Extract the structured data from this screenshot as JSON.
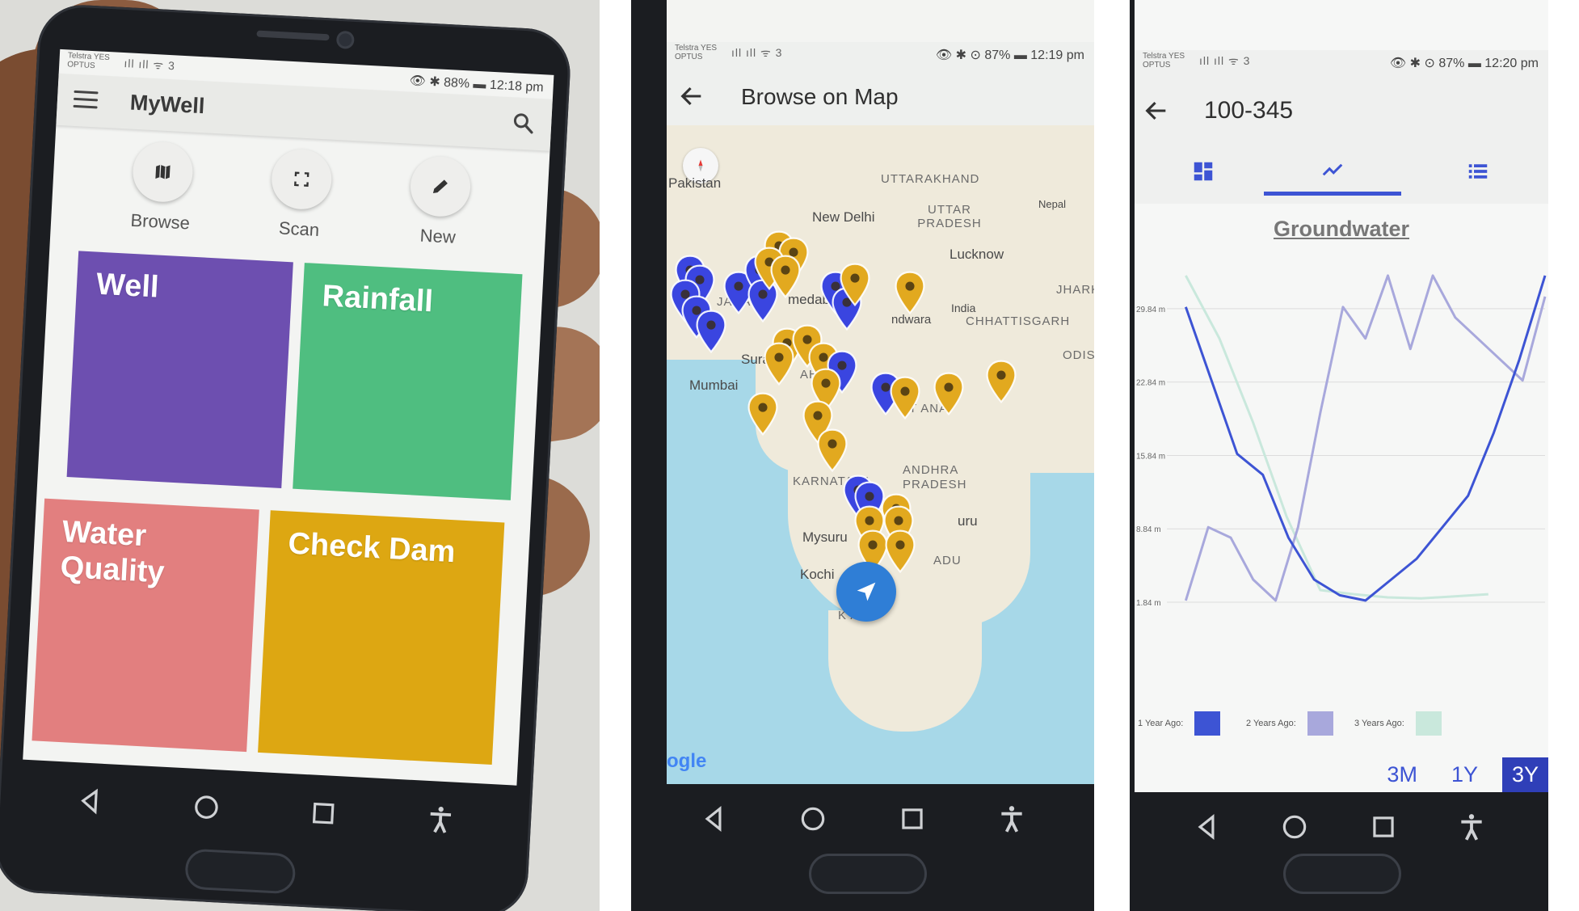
{
  "panel1": {
    "status": {
      "carrier": "Telstra YES OPTUS",
      "signal": "ıll ıll ᯤ 3",
      "right": "👁 ✱ 88% ▬ 12:18 pm"
    },
    "appbar": {
      "title": "MyWell"
    },
    "actions": [
      {
        "label": "Browse",
        "icon": "map-icon"
      },
      {
        "label": "Scan",
        "icon": "scan-icon"
      },
      {
        "label": "New",
        "icon": "pencil-icon"
      }
    ],
    "tiles": [
      {
        "label": "Well",
        "color": "#6d4fb0"
      },
      {
        "label": "Rainfall",
        "color": "#4fbe80"
      },
      {
        "label": "Water Quality",
        "color": "#e27f7f"
      },
      {
        "label": "Check Dam",
        "color": "#dda712"
      }
    ]
  },
  "panel2": {
    "status": {
      "carrier": "Telstra YES OPTUS",
      "signal": "ıll ıll ᯤ 3",
      "right": "👁 ✱ ⊙ 87% ▬ 12:19 pm"
    },
    "title": "Browse on Map",
    "map_labels": {
      "pakistan": "Pakistan",
      "uttarakhand": "UTTARAKHAND",
      "new_delhi": "New Delhi",
      "nepal": "Nepal",
      "uttar_pradesh": "UTTAR PRADESH",
      "lucknow": "Lucknow",
      "jhark": "JHARK",
      "gujarat": "JARAT",
      "ahmedabad": "medabad",
      "chhindwara": "ndwara",
      "india": "India",
      "chhattisgarh": "CHHATTISGARH",
      "surat": "Sura",
      "odisha": "ODISI",
      "mumbai": "Mumbai",
      "maharashtra": "AHA",
      "telangana": "T  ANA",
      "karnataka": "KARNATAKA",
      "andhra": "ANDHRA PRADESH",
      "bengaluru": "uru",
      "mysuru": "Mysuru",
      "kochi": "Kochi",
      "tamil": "ADU",
      "kerala": "K   A",
      "google": "ogle"
    },
    "pin_colors": {
      "well": "#3a45e0",
      "other": "#e2a91f"
    }
  },
  "panel3": {
    "status": {
      "carrier": "Telstra YES OPTUS",
      "signal": "ıll ıll ᯤ 3",
      "right": "👁 ✱ ⊙ 87% ▬ 12:20 pm"
    },
    "title": "100-345",
    "tabs": [
      "dashboard-icon",
      "chart-line-icon",
      "list-icon"
    ],
    "chart_title": "Groundwater",
    "legend": [
      {
        "label": "1 Year Ago:",
        "color": "#3d54d4"
      },
      {
        "label": "2 Years Ago:",
        "color": "#a8a8dc"
      },
      {
        "label": "3 Years Ago:",
        "color": "#c9e8dc"
      }
    ],
    "ranges": [
      "3M",
      "1Y",
      "3Y"
    ],
    "active_range": "3Y"
  },
  "chart_data": {
    "type": "line",
    "title": "Groundwater",
    "xlabel": "",
    "ylabel": "",
    "y_ticks": [
      "29.84 m",
      "22.84 m",
      "15.84 m",
      "8.84 m",
      "1.84 m"
    ],
    "ylim": [
      1.84,
      29.84
    ],
    "series": [
      {
        "name": "1 Year Ago:",
        "color": "#3d54d4",
        "values": [
          30,
          23,
          16,
          14,
          8,
          4,
          2.5,
          2,
          4,
          6,
          9,
          12,
          18,
          25,
          33
        ]
      },
      {
        "name": "2 Years Ago:",
        "color": "#a8a8dc",
        "values": [
          2,
          9,
          8,
          4,
          2,
          9,
          20,
          30,
          27,
          33,
          26,
          33,
          29,
          27,
          25,
          23,
          31
        ]
      },
      {
        "name": "3 Years Ago:",
        "color": "#c9e8dc",
        "values": [
          33,
          27,
          19,
          10,
          3,
          2.6,
          2.3,
          2.2,
          2.4,
          2.6
        ]
      }
    ]
  }
}
